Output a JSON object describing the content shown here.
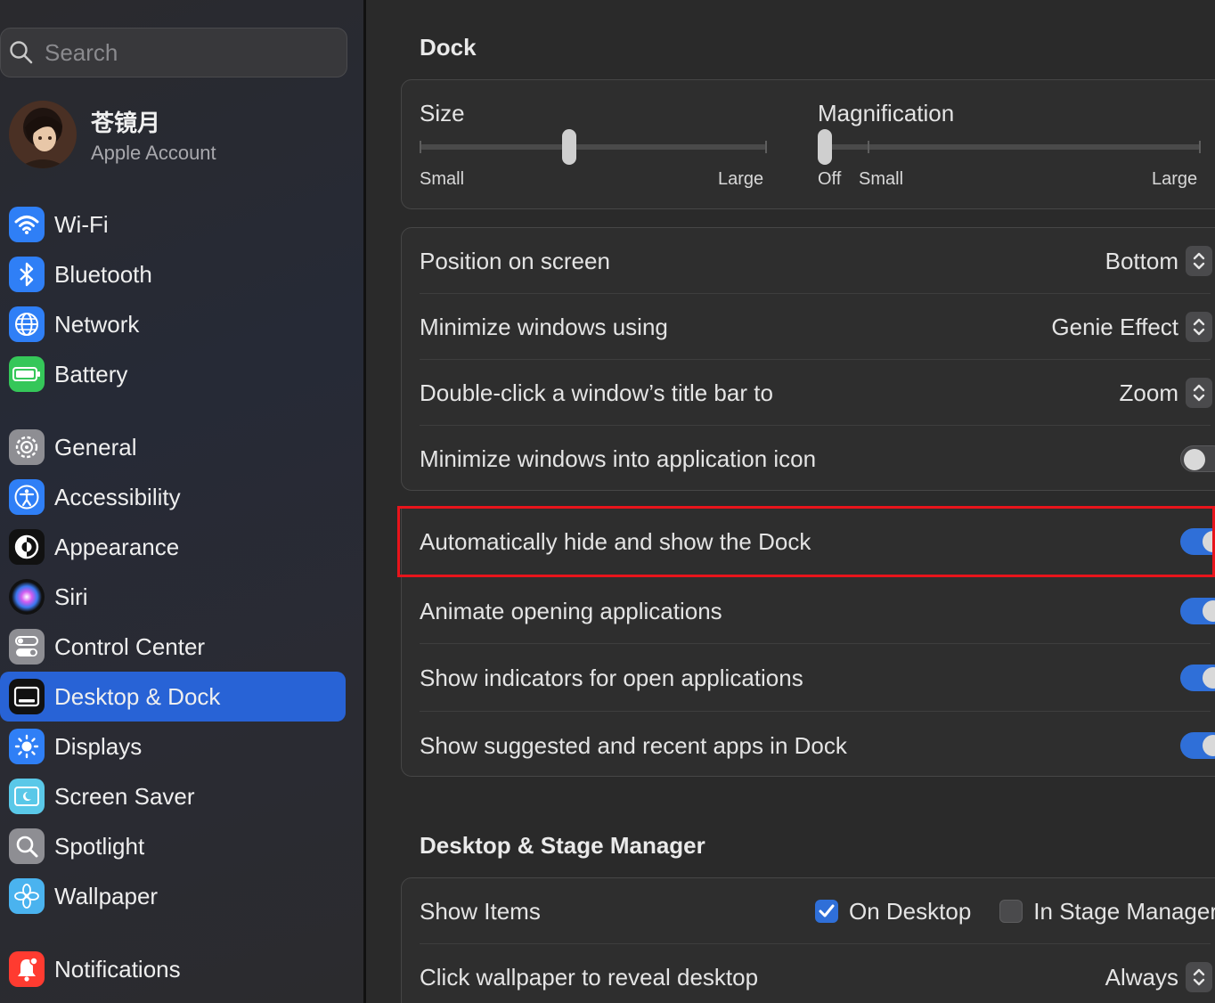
{
  "search": {
    "placeholder": "Search"
  },
  "account": {
    "name": "苍镜月",
    "subtitle": "Apple Account"
  },
  "sidebar": {
    "items": [
      {
        "label": "Wi-Fi",
        "icon": "wifi-icon",
        "color": "#2f7ff6"
      },
      {
        "label": "Bluetooth",
        "icon": "bluetooth-icon",
        "color": "#2f7ff6"
      },
      {
        "label": "Network",
        "icon": "globe-icon",
        "color": "#2f7ff6"
      },
      {
        "label": "Battery",
        "icon": "battery-icon",
        "color": "#35c759"
      },
      {
        "label": "General",
        "icon": "gear-icon",
        "color": "#8e8e93"
      },
      {
        "label": "Accessibility",
        "icon": "accessibility-icon",
        "color": "#2f7ff6"
      },
      {
        "label": "Appearance",
        "icon": "appearance-icon",
        "color": "#1c1c1e"
      },
      {
        "label": "Siri",
        "icon": "siri-icon",
        "color": "#7a3cf0"
      },
      {
        "label": "Control Center",
        "icon": "control-center-icon",
        "color": "#8e8e93"
      },
      {
        "label": "Desktop & Dock",
        "icon": "dock-icon",
        "color": "#1c1c1e"
      },
      {
        "label": "Displays",
        "icon": "sun-icon",
        "color": "#2f7ff6"
      },
      {
        "label": "Screen Saver",
        "icon": "screen-saver-icon",
        "color": "#5ac8e8"
      },
      {
        "label": "Spotlight",
        "icon": "magnifier-icon",
        "color": "#8e8e93"
      },
      {
        "label": "Wallpaper",
        "icon": "flower-icon",
        "color": "#4ab3ef"
      },
      {
        "label": "Notifications",
        "icon": "bell-icon",
        "color": "#ff3b30"
      }
    ],
    "active": "Desktop & Dock"
  },
  "dock": {
    "title": "Dock",
    "size": {
      "label": "Size",
      "min_label": "Small",
      "max_label": "Large",
      "value": 0.43
    },
    "magnification": {
      "label": "Magnification",
      "off_label": "Off",
      "min_label": "Small",
      "max_label": "Large",
      "value": 0.0
    },
    "position": {
      "label": "Position on screen",
      "value": "Bottom"
    },
    "minimize_using": {
      "label": "Minimize windows using",
      "value": "Genie Effect"
    },
    "double_click": {
      "label": "Double-click a window’s title bar to",
      "value": "Zoom"
    },
    "minimize_into_icon": {
      "label": "Minimize windows into application icon",
      "on": false
    },
    "auto_hide": {
      "label": "Automatically hide and show the Dock",
      "on": true
    },
    "animate": {
      "label": "Animate opening applications",
      "on": true
    },
    "indicators": {
      "label": "Show indicators for open applications",
      "on": true
    },
    "suggested": {
      "label": "Show suggested and recent apps in Dock",
      "on": true
    }
  },
  "stage": {
    "title": "Desktop & Stage Manager",
    "show_items": {
      "label": "Show Items",
      "on_desktop": "On Desktop",
      "in_stage_manager": "In Stage Manager",
      "desktop_checked": true,
      "stage_checked": false
    },
    "click_wallpaper": {
      "label": "Click wallpaper to reveal desktop",
      "value": "Always"
    }
  },
  "colors": {
    "accent": "#2f6fd8",
    "highlight": "#e8141b",
    "active_item": "#2863d6"
  }
}
